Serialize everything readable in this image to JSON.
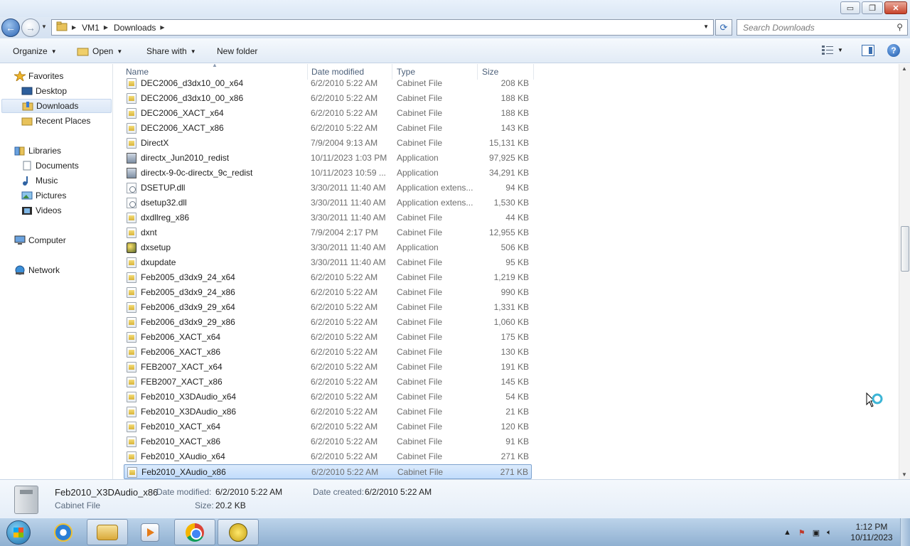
{
  "window": {
    "min_label": "▭",
    "max_label": "❐",
    "close_label": "✕"
  },
  "address": {
    "crumbs": [
      "VM1",
      "Downloads"
    ]
  },
  "search": {
    "placeholder": "Search Downloads"
  },
  "toolbar": {
    "organize": "Organize",
    "open": "Open",
    "share": "Share with",
    "new_folder": "New folder"
  },
  "nav": {
    "favorites": "Favorites",
    "desktop": "Desktop",
    "downloads": "Downloads",
    "recent": "Recent Places",
    "libraries": "Libraries",
    "documents": "Documents",
    "music": "Music",
    "pictures": "Pictures",
    "videos": "Videos",
    "computer": "Computer",
    "network": "Network"
  },
  "columns": {
    "name": "Name",
    "date": "Date modified",
    "type": "Type",
    "size": "Size"
  },
  "files": [
    {
      "name": "DEC2006_d3dx10_00_x64",
      "date": "6/2/2010 5:22 AM",
      "type": "Cabinet File",
      "size": "208 KB",
      "icon": "cabinet-file-icon"
    },
    {
      "name": "DEC2006_d3dx10_00_x86",
      "date": "6/2/2010 5:22 AM",
      "type": "Cabinet File",
      "size": "188 KB",
      "icon": "cabinet-file-icon"
    },
    {
      "name": "DEC2006_XACT_x64",
      "date": "6/2/2010 5:22 AM",
      "type": "Cabinet File",
      "size": "188 KB",
      "icon": "cabinet-file-icon"
    },
    {
      "name": "DEC2006_XACT_x86",
      "date": "6/2/2010 5:22 AM",
      "type": "Cabinet File",
      "size": "143 KB",
      "icon": "cabinet-file-icon"
    },
    {
      "name": "DirectX",
      "date": "7/9/2004 9:13 AM",
      "type": "Cabinet File",
      "size": "15,131 KB",
      "icon": "cabinet-file-icon"
    },
    {
      "name": "directx_Jun2010_redist",
      "date": "10/11/2023 1:03 PM",
      "type": "Application",
      "size": "97,925 KB",
      "icon": "application-icon"
    },
    {
      "name": "directx-9-0c-directx_9c_redist",
      "date": "10/11/2023 10:59 ...",
      "type": "Application",
      "size": "34,291 KB",
      "icon": "application-icon"
    },
    {
      "name": "DSETUP.dll",
      "date": "3/30/2011 11:40 AM",
      "type": "Application extens...",
      "size": "94 KB",
      "icon": "dll-file-icon"
    },
    {
      "name": "dsetup32.dll",
      "date": "3/30/2011 11:40 AM",
      "type": "Application extens...",
      "size": "1,530 KB",
      "icon": "dll-file-icon"
    },
    {
      "name": "dxdllreg_x86",
      "date": "3/30/2011 11:40 AM",
      "type": "Cabinet File",
      "size": "44 KB",
      "icon": "cabinet-file-icon"
    },
    {
      "name": "dxnt",
      "date": "7/9/2004 2:17 PM",
      "type": "Cabinet File",
      "size": "12,955 KB",
      "icon": "cabinet-file-icon"
    },
    {
      "name": "dxsetup",
      "date": "3/30/2011 11:40 AM",
      "type": "Application",
      "size": "506 KB",
      "icon": "setup-application-icon"
    },
    {
      "name": "dxupdate",
      "date": "3/30/2011 11:40 AM",
      "type": "Cabinet File",
      "size": "95 KB",
      "icon": "cabinet-file-icon"
    },
    {
      "name": "Feb2005_d3dx9_24_x64",
      "date": "6/2/2010 5:22 AM",
      "type": "Cabinet File",
      "size": "1,219 KB",
      "icon": "cabinet-file-icon"
    },
    {
      "name": "Feb2005_d3dx9_24_x86",
      "date": "6/2/2010 5:22 AM",
      "type": "Cabinet File",
      "size": "990 KB",
      "icon": "cabinet-file-icon"
    },
    {
      "name": "Feb2006_d3dx9_29_x64",
      "date": "6/2/2010 5:22 AM",
      "type": "Cabinet File",
      "size": "1,331 KB",
      "icon": "cabinet-file-icon"
    },
    {
      "name": "Feb2006_d3dx9_29_x86",
      "date": "6/2/2010 5:22 AM",
      "type": "Cabinet File",
      "size": "1,060 KB",
      "icon": "cabinet-file-icon"
    },
    {
      "name": "Feb2006_XACT_x64",
      "date": "6/2/2010 5:22 AM",
      "type": "Cabinet File",
      "size": "175 KB",
      "icon": "cabinet-file-icon"
    },
    {
      "name": "Feb2006_XACT_x86",
      "date": "6/2/2010 5:22 AM",
      "type": "Cabinet File",
      "size": "130 KB",
      "icon": "cabinet-file-icon"
    },
    {
      "name": "FEB2007_XACT_x64",
      "date": "6/2/2010 5:22 AM",
      "type": "Cabinet File",
      "size": "191 KB",
      "icon": "cabinet-file-icon"
    },
    {
      "name": "FEB2007_XACT_x86",
      "date": "6/2/2010 5:22 AM",
      "type": "Cabinet File",
      "size": "145 KB",
      "icon": "cabinet-file-icon"
    },
    {
      "name": "Feb2010_X3DAudio_x64",
      "date": "6/2/2010 5:22 AM",
      "type": "Cabinet File",
      "size": "54 KB",
      "icon": "cabinet-file-icon"
    },
    {
      "name": "Feb2010_X3DAudio_x86",
      "date": "6/2/2010 5:22 AM",
      "type": "Cabinet File",
      "size": "21 KB",
      "icon": "cabinet-file-icon"
    },
    {
      "name": "Feb2010_XACT_x64",
      "date": "6/2/2010 5:22 AM",
      "type": "Cabinet File",
      "size": "120 KB",
      "icon": "cabinet-file-icon"
    },
    {
      "name": "Feb2010_XACT_x86",
      "date": "6/2/2010 5:22 AM",
      "type": "Cabinet File",
      "size": "91 KB",
      "icon": "cabinet-file-icon"
    },
    {
      "name": "Feb2010_XAudio_x64",
      "date": "6/2/2010 5:22 AM",
      "type": "Cabinet File",
      "size": "271 KB",
      "icon": "cabinet-file-icon"
    },
    {
      "name": "Feb2010_XAudio_x86",
      "date": "6/2/2010 5:22 AM",
      "type": "Cabinet File",
      "size": "271 KB",
      "icon": "cabinet-file-icon",
      "selected": true
    }
  ],
  "details": {
    "name": "Feb2010_X3DAudio_x86",
    "kind": "Cabinet File",
    "modified_label": "Date modified:",
    "modified": "6/2/2010 5:22 AM",
    "created_label": "Date created:",
    "created": "6/2/2010 5:22 AM",
    "size_label": "Size:",
    "size": "20.2 KB"
  },
  "clock": {
    "time": "1:12 PM",
    "date": "10/11/2023"
  }
}
